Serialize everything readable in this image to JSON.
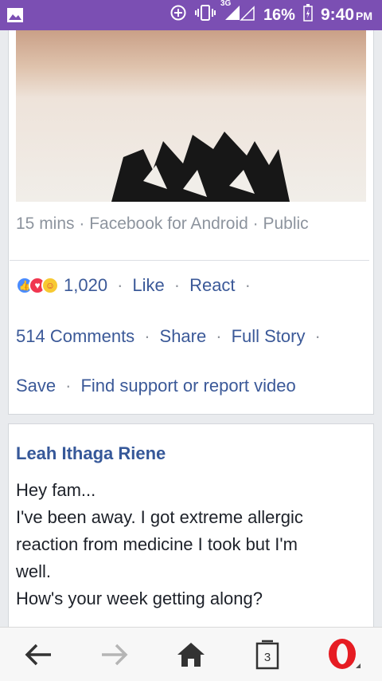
{
  "status_bar": {
    "network": "3G",
    "battery": "16%",
    "time": "9:40",
    "ampm": "PM"
  },
  "post": {
    "meta": "15 mins · Facebook for Android · Public",
    "reaction_count": "1,020",
    "actions_row1": [
      "Like",
      "React"
    ],
    "actions_row2": [
      "514 Comments",
      "Share",
      "Full Story"
    ],
    "actions_row3": [
      "Save",
      "Find support or report video"
    ],
    "sep": "·"
  },
  "comment": {
    "author": "Leah Ithaga Riene",
    "lines": [
      "Hey fam...",
      "I've been away. I got extreme allergic",
      "reaction from medicine I took but I'm",
      "well.",
      "How's your week getting along?"
    ]
  },
  "bottom_nav": {
    "tab_count": "3"
  },
  "icons": {
    "status": [
      "image-icon",
      "data-saver-icon",
      "vibrate-icon",
      "signal-icon",
      "battery-icon"
    ],
    "nav": [
      "back-arrow-icon",
      "forward-arrow-icon",
      "home-icon",
      "tabs-icon",
      "opera-icon"
    ]
  },
  "colors": {
    "status_bar": "#7b4fb3",
    "link": "#3b5998",
    "opera_red": "#e61c23"
  }
}
